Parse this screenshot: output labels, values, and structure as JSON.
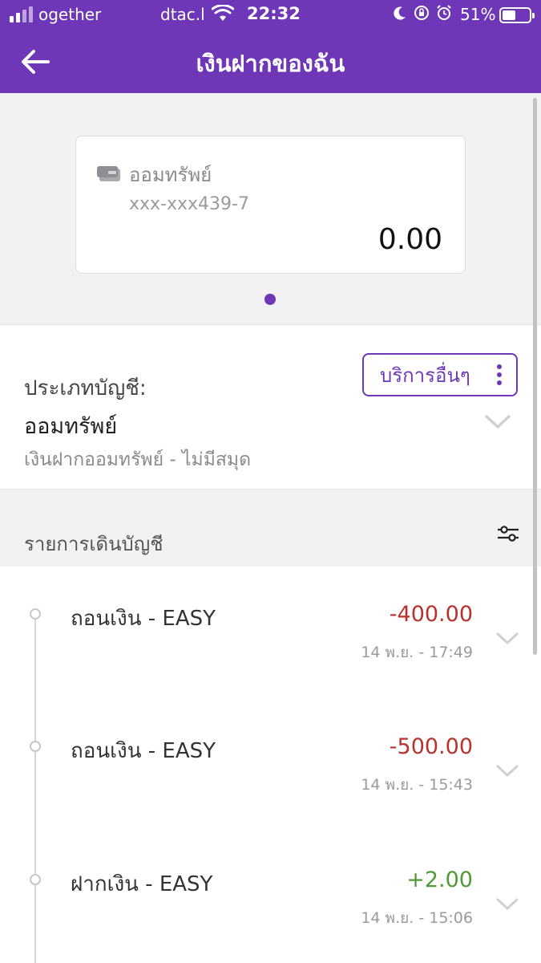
{
  "status_bar": {
    "carrier": "ogether",
    "network": "dtac.l",
    "time": "22:32",
    "battery_pct": "51%"
  },
  "nav": {
    "title": "เงินฝากของฉัน"
  },
  "card": {
    "account_type": "ออมทรัพย์",
    "account_number": "xxx-xxx439-7",
    "balance": "0.00"
  },
  "account_info": {
    "type_label": "ประเภทบัญชี:",
    "account_name": "ออมทรัพย์",
    "description": "เงินฝากออมทรัพย์ - ไม่มีสมุด",
    "services_button": "บริการอื่นๆ"
  },
  "statement": {
    "title": "รายการเดินบัญชี",
    "transactions": [
      {
        "name": "ถอนเงิน - EASY",
        "amount": "-400.00",
        "date": "14 พ.ย. - 17:49",
        "direction": "out"
      },
      {
        "name": "ถอนเงิน - EASY",
        "amount": "-500.00",
        "date": "14 พ.ย. - 15:43",
        "direction": "out"
      },
      {
        "name": "ฝากเงิน - EASY",
        "amount": "+2.00",
        "date": "14 พ.ย. - 15:06",
        "direction": "in"
      }
    ]
  },
  "colors": {
    "brand": "#6e37b8",
    "negative": "#b8322e",
    "positive": "#4f9a35"
  }
}
